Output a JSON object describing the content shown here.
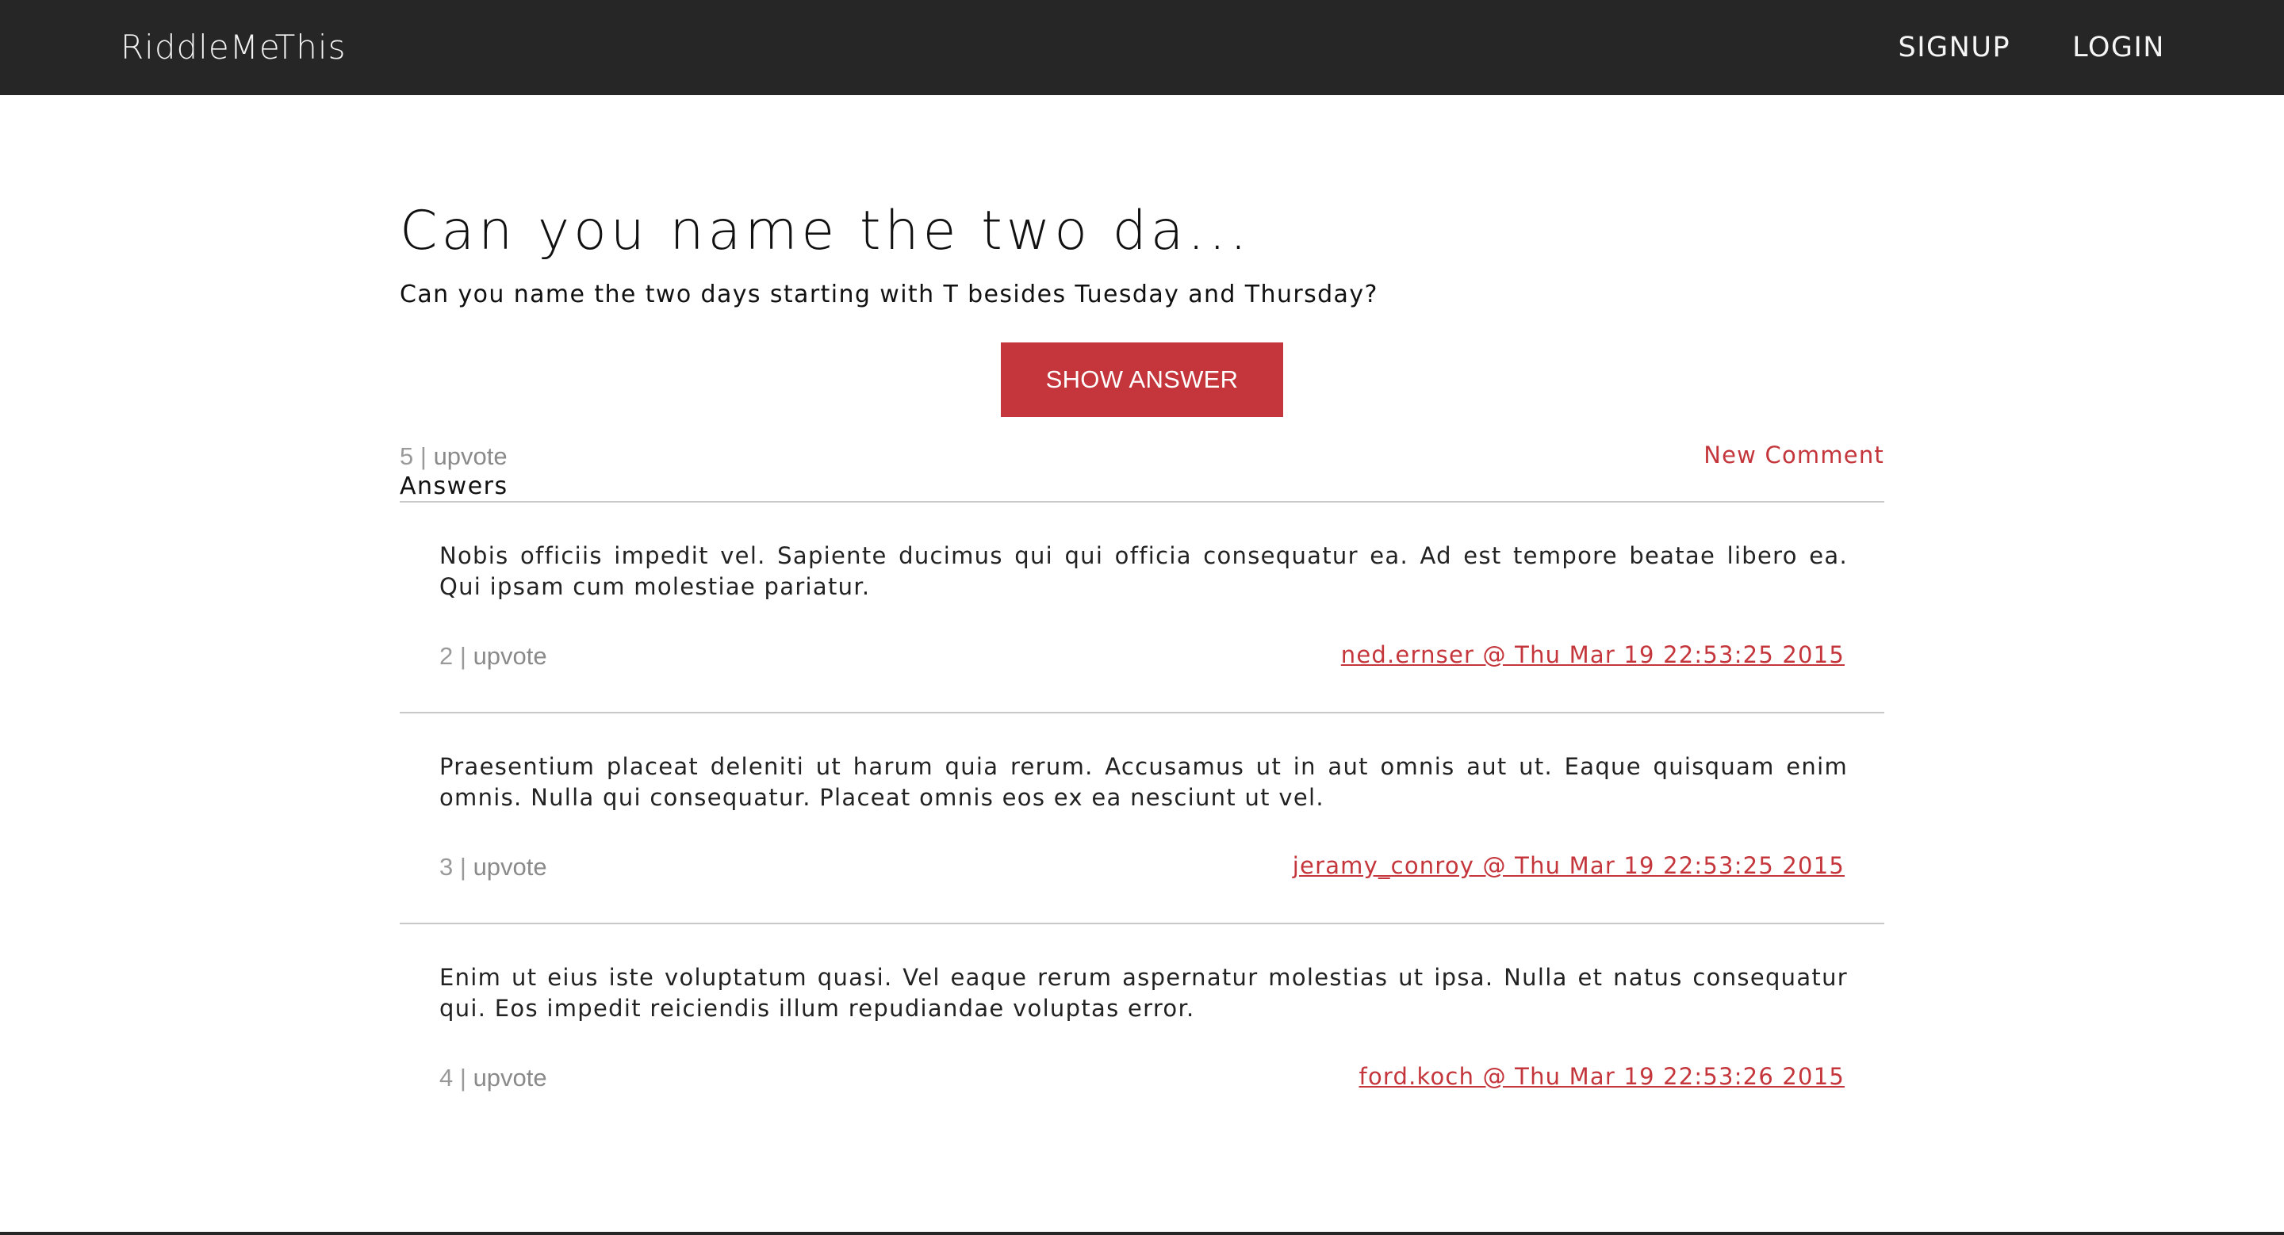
{
  "app": {
    "brand": "RiddleMeThis"
  },
  "nav": {
    "items": [
      {
        "label": "SIGNUP"
      },
      {
        "label": "LOGIN"
      }
    ]
  },
  "riddle": {
    "title": "Can you name the two da...",
    "text": "Can you name the two days starting with T besides Tuesday and Thursday?",
    "show_answer_label": "SHOW ANSWER",
    "votes": "5",
    "separator": "|",
    "upvote_label": "upvote",
    "new_comment_label": "New Comment"
  },
  "answers_section": {
    "heading": "Answers",
    "items": [
      {
        "text": "Nobis officiis impedit vel. Sapiente ducimus qui qui officia consequatur ea. Ad est tempore beatae libero ea. Qui ipsam cum molestiae pariatur.",
        "votes": "2",
        "upvote_label": "upvote",
        "meta": "ned.ernser @ Thu Mar 19 22:53:25 2015"
      },
      {
        "text": "Praesentium placeat deleniti ut harum quia rerum. Accusamus ut in aut omnis aut ut. Eaque quisquam enim omnis. Nulla qui consequatur. Placeat omnis eos ex ea nesciunt ut vel.",
        "votes": "3",
        "upvote_label": "upvote",
        "meta": "jeramy_conroy @ Thu Mar 19 22:53:25 2015"
      },
      {
        "text": "Enim ut eius iste voluptatum quasi. Vel eaque rerum aspernatur molestias ut ipsa. Nulla et natus consequatur qui. Eos impedit reiciendis illum repudiandae voluptas error.",
        "votes": "4",
        "upvote_label": "upvote",
        "meta": "ford.koch @ Thu Mar 19 22:53:26 2015"
      }
    ]
  },
  "colors": {
    "topbar": "#262626",
    "accent": "#c4363b",
    "muted": "#9a9a9a",
    "rule": "#c8c8c8"
  }
}
